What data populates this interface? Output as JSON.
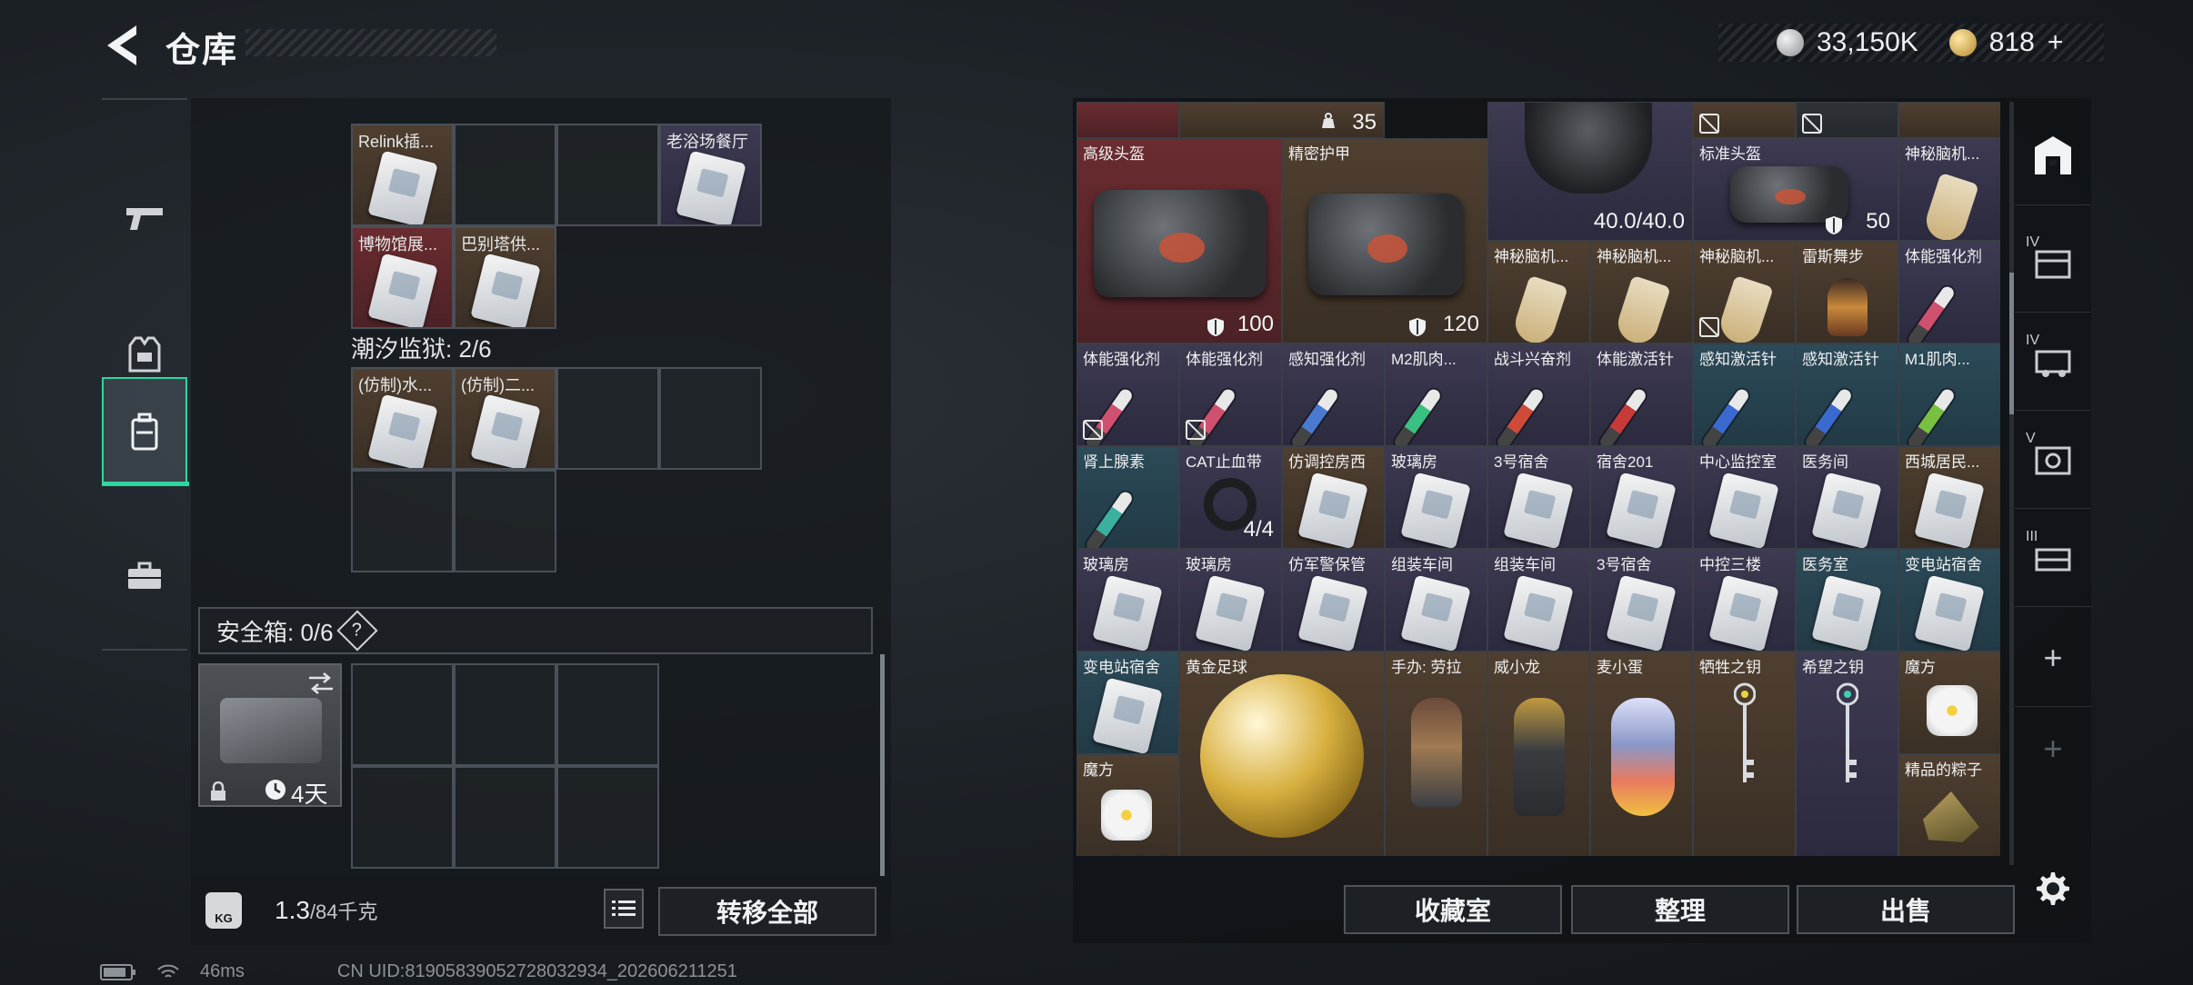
{
  "header": {
    "title": "仓库",
    "currency": {
      "silver": "33,150K",
      "gold": "818",
      "gold_add": "+"
    }
  },
  "left_sidebar": {
    "tabs": [
      {
        "name": "weapons",
        "icon": "pistol-icon",
        "active": false
      },
      {
        "name": "armor",
        "icon": "armor-vest-icon",
        "active": false
      },
      {
        "name": "backpack",
        "icon": "backpack-icon",
        "active": true
      },
      {
        "name": "keys",
        "icon": "briefcase-icon",
        "active": false
      }
    ]
  },
  "left_panel": {
    "keycard_group": {
      "items": [
        {
          "label": "Relink插...",
          "bg": "brown"
        },
        {
          "label": "老浴场餐厅",
          "bg": "purple"
        },
        {
          "label": "博物馆展...",
          "bg": "red"
        },
        {
          "label": "巴别塔供...",
          "bg": "brown"
        }
      ]
    },
    "prison_label": "潮汐监狱: 2/6",
    "prison_items": [
      {
        "label": "(仿制)水...",
        "bg": "brown"
      },
      {
        "label": "(仿制)二...",
        "bg": "brown"
      }
    ],
    "safebox": {
      "label": "安全箱: 0/6",
      "help": "?",
      "duration": "4天"
    },
    "footer": {
      "weight": "1.3",
      "weight_max": "/84千克",
      "weight_icon_text": "KG",
      "transfer_all": "转移全部"
    }
  },
  "status_bar": {
    "ping": "46ms",
    "uid": "CN UID:81905839052728032934_202606211251"
  },
  "right_panel": {
    "top_partial": [
      {
        "qty": "35"
      }
    ],
    "items": [
      {
        "label": "高级头盔",
        "qty": "100",
        "bg": "red"
      },
      {
        "label": "精密护甲",
        "qty": "120",
        "bg": "brown"
      },
      {
        "label": "",
        "qty": "40.0/40.0",
        "bg": "purple"
      },
      {
        "label": "标准头盔",
        "qty": "50",
        "bg": "purple"
      },
      {
        "label": "神秘脑机...",
        "bg": "purple"
      },
      {
        "label": "神秘脑机...",
        "bg": "brown"
      },
      {
        "label": "神秘脑机...",
        "bg": "brown"
      },
      {
        "label": "神秘脑机...",
        "bg": "brown"
      },
      {
        "label": "雷斯舞步",
        "bg": "brown"
      },
      {
        "label": "体能强化剂",
        "bg": "purple"
      },
      {
        "label": "体能强化剂",
        "bg": "purple"
      },
      {
        "label": "体能强化剂",
        "bg": "purple"
      },
      {
        "label": "感知强化剂",
        "bg": "purple"
      },
      {
        "label": "M2肌肉...",
        "bg": "purple"
      },
      {
        "label": "战斗兴奋剂",
        "bg": "purple"
      },
      {
        "label": "体能激活针",
        "bg": "purple"
      },
      {
        "label": "感知激活针",
        "bg": "blue"
      },
      {
        "label": "感知激活针",
        "bg": "blue"
      },
      {
        "label": "M1肌肉...",
        "bg": "blue"
      },
      {
        "label": "肾上腺素",
        "bg": "blue"
      },
      {
        "label": "CAT止血带",
        "qty": "4/4",
        "bg": "purple"
      },
      {
        "label": "仿调控房西",
        "bg": "brown"
      },
      {
        "label": "玻璃房",
        "bg": "purple"
      },
      {
        "label": "3号宿舍",
        "bg": "purple"
      },
      {
        "label": "宿舍201",
        "bg": "purple"
      },
      {
        "label": "中心监控室",
        "bg": "purple"
      },
      {
        "label": "医务间",
        "bg": "purple"
      },
      {
        "label": "西城居民...",
        "bg": "brown"
      },
      {
        "label": "玻璃房",
        "bg": "purple"
      },
      {
        "label": "玻璃房",
        "bg": "purple"
      },
      {
        "label": "仿军警保管",
        "bg": "purple"
      },
      {
        "label": "组装车间",
        "bg": "purple"
      },
      {
        "label": "组装车间",
        "bg": "purple"
      },
      {
        "label": "3号宿舍",
        "bg": "purple"
      },
      {
        "label": "中控三楼",
        "bg": "purple"
      },
      {
        "label": "医务室",
        "bg": "blue"
      },
      {
        "label": "变电站宿舍",
        "bg": "blue"
      },
      {
        "label": "变电站宿舍",
        "bg": "blue"
      },
      {
        "label": "黄金足球",
        "bg": "brown"
      },
      {
        "label": "手办: 劳拉",
        "bg": "brown"
      },
      {
        "label": "威小龙",
        "bg": "brown"
      },
      {
        "label": "麦小蛋",
        "bg": "brown"
      },
      {
        "label": "牺牲之钥",
        "bg": "brown"
      },
      {
        "label": "希望之钥",
        "bg": "purple"
      },
      {
        "label": "魔方",
        "bg": "brown"
      },
      {
        "label": "魔方",
        "bg": "brown"
      },
      {
        "label": "精品的粽子",
        "bg": "brown"
      }
    ],
    "footer": {
      "collection": "收藏室",
      "organize": "整理",
      "sell": "出售"
    }
  },
  "right_sidebar": {
    "tabs": [
      {
        "roman": "",
        "icon": "storage-icon",
        "active": true
      },
      {
        "roman": "IV",
        "icon": "container-icon"
      },
      {
        "roman": "IV",
        "icon": "vehicle-icon"
      },
      {
        "roman": "V",
        "icon": "safe-icon"
      },
      {
        "roman": "III",
        "icon": "crate-icon"
      }
    ],
    "add_label": "+"
  },
  "colors": {
    "accent": "#2fd6a0",
    "bg_red": "#6a2c30",
    "bg_brown": "#4f3f30",
    "bg_purple": "#3d3a52",
    "bg_blue": "#2c4a58"
  }
}
